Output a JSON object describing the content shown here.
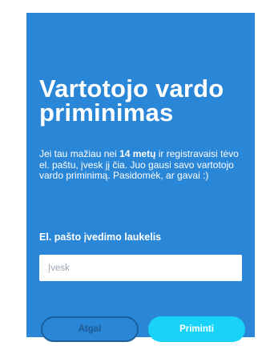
{
  "colors": {
    "card_background": "#2a86d6",
    "page_background": "#ffffff",
    "primary_button": "#18d3f7",
    "secondary_button_border": "#1e5f9a",
    "text_light": "#ffffff"
  },
  "header": {
    "title": "Vartotojo vardo priminimas"
  },
  "description": {
    "part1": "Jei tau mažiau nei ",
    "age_highlight": "14 metų",
    "part2": " ir registravaisi tėvo el. paštu, įvesk jį čia. Juo gausi savo vartotojo vardo priminimą. Pasidomėk, ar gavai :)"
  },
  "form": {
    "email_label": "El. pašto įvedimo laukelis",
    "email_value": "",
    "email_placeholder": "Įvesk"
  },
  "actions": {
    "back_label": "Atgal",
    "submit_label": "Priminti"
  }
}
